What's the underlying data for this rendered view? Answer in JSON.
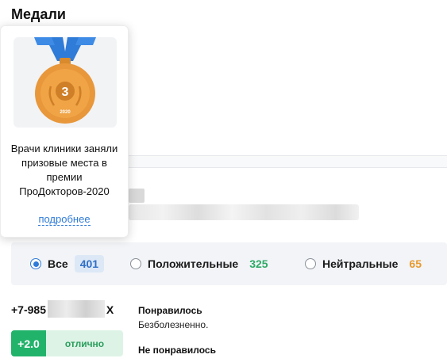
{
  "section": {
    "title": "Медали"
  },
  "medal_popup": {
    "medal_number": "3",
    "medal_year": "2020",
    "description": "Врачи клиники заняли призовые места в премии ПроДокторов-2020",
    "more_link": "подробнее"
  },
  "filters": [
    {
      "label": "Все",
      "count": "401",
      "selected": true
    },
    {
      "label": "Положительные",
      "count": "325",
      "selected": false
    },
    {
      "label": "Нейтральные",
      "count": "65",
      "selected": false
    }
  ],
  "review": {
    "phone": "+7-985",
    "phone_suffix": "X",
    "rating_score": "+2.0",
    "rating_label": "отлично",
    "liked_heading": "Понравилось",
    "liked_text": "Безболезненно.",
    "disliked_heading": "Не понравилось"
  },
  "colors": {
    "accent": "#2f7bd8",
    "positive": "#22b36b",
    "neutral": "#e89a2e",
    "medal": "#e8973b",
    "ribbon": "#2f7bd8"
  }
}
